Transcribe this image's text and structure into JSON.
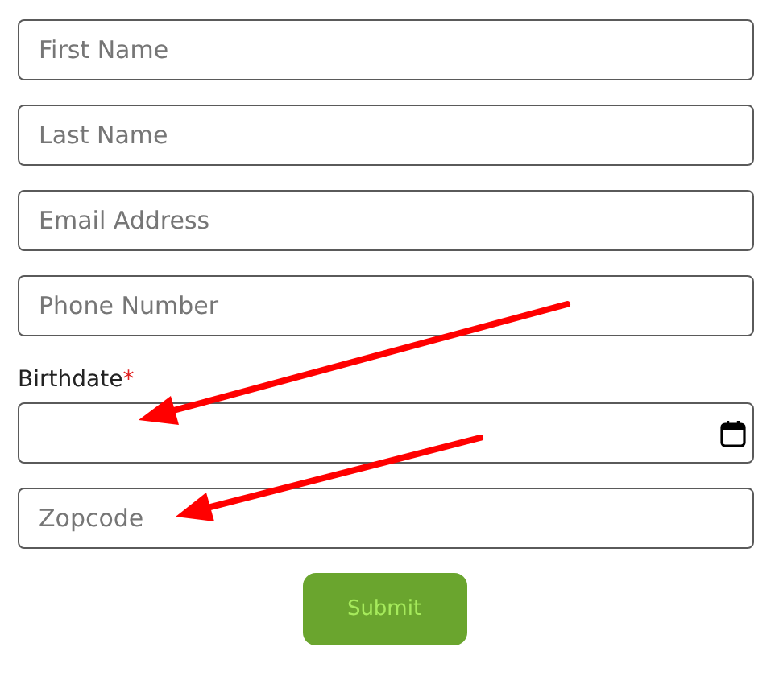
{
  "form": {
    "fields": [
      {
        "kind": "text",
        "placeholder": "First Name"
      },
      {
        "kind": "text",
        "placeholder": "Last Name"
      },
      {
        "kind": "text",
        "placeholder": "Email Address"
      },
      {
        "kind": "text",
        "placeholder": "Phone Number"
      },
      {
        "kind": "date",
        "label": "Birthdate",
        "required_mark": "*"
      },
      {
        "kind": "text",
        "placeholder": "Zopcode"
      }
    ],
    "submit": "Submit"
  }
}
